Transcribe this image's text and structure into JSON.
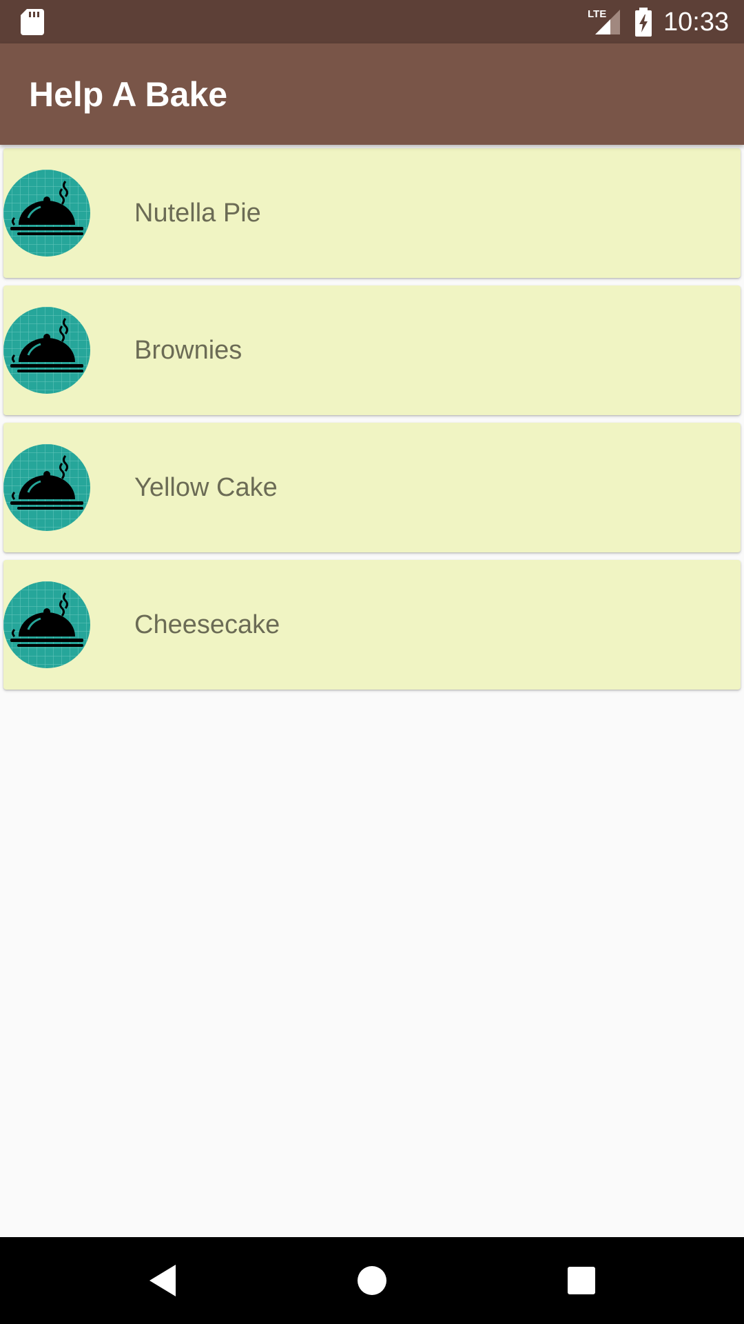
{
  "status_bar": {
    "time": "10:33",
    "network_label": "LTE",
    "icons": [
      "sd-card-icon",
      "lte-signal-icon",
      "battery-charging-icon"
    ]
  },
  "app_bar": {
    "title": "Help A Bake",
    "color": "#795548",
    "status_color": "#5d4037"
  },
  "recipes": [
    {
      "name": "Nutella Pie",
      "icon": "serving-cloche-icon"
    },
    {
      "name": "Brownies",
      "icon": "serving-cloche-icon"
    },
    {
      "name": "Yellow Cake",
      "icon": "serving-cloche-icon"
    },
    {
      "name": "Cheesecake",
      "icon": "serving-cloche-icon"
    }
  ],
  "card_color": "#f0f4c3",
  "avatar_color": "#26a69a",
  "nav_bar": {
    "buttons": [
      "back-icon",
      "home-icon",
      "recents-icon"
    ]
  }
}
